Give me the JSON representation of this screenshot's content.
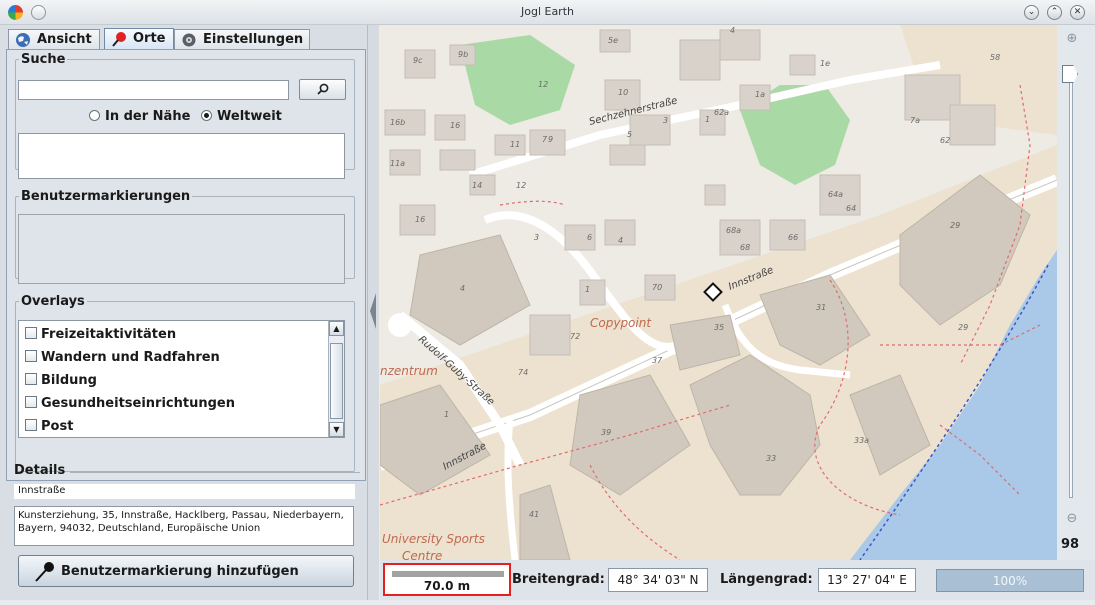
{
  "window": {
    "title": "Jogl Earth"
  },
  "tabs": [
    {
      "label": "Ansicht",
      "icon": "globe-icon"
    },
    {
      "label": "Orte",
      "icon": "pin-icon"
    },
    {
      "label": "Einstellungen",
      "icon": "settings-gear-icon"
    }
  ],
  "search": {
    "legend": "Suche",
    "input_value": "",
    "radio_nearby": "In der Nähe",
    "radio_worldwide": "Weltweit",
    "selected": "Weltweit"
  },
  "markers": {
    "legend": "Benutzermarkierungen"
  },
  "overlays": {
    "legend": "Overlays",
    "items": [
      "Freizeitaktivitäten",
      "Wandern und Radfahren",
      "Bildung",
      "Gesundheitseinrichtungen",
      "Post"
    ]
  },
  "details": {
    "legend": "Details",
    "name": "Innstraße",
    "address": "Kunsterziehung, 35, Innstraße, Hacklberg, Passau, Niederbayern, Bayern, 94032, Deutschland, Europäische Union",
    "add_button": "Benutzermarkierung hinzufügen"
  },
  "map": {
    "streets": [
      "Sechzehnerstraße",
      "Innstraße",
      "Rudolf-Guby-Straße",
      "Innstraße"
    ],
    "place_labels": [
      "Copypoint",
      "nzentrum",
      "University Sports",
      "Centre"
    ],
    "house_numbers": [
      "5e",
      "9c",
      "9b",
      "4",
      "1e",
      "58",
      "12",
      "10",
      "1a",
      "16b",
      "16",
      "3",
      "1",
      "62a",
      "7a",
      "7",
      "9",
      "11",
      "5",
      "62",
      "11a",
      "14",
      "12",
      "64a",
      "64",
      "16",
      "3",
      "6",
      "4",
      "68a",
      "68",
      "66",
      "29",
      "4",
      "1",
      "70",
      "31",
      "35",
      "72",
      "29",
      "37",
      "74",
      "1",
      "39",
      "33a",
      "33",
      "41"
    ]
  },
  "zoom": {
    "level": "98"
  },
  "statusbar": {
    "scale": "70.0 m",
    "lat_label": "Breitengrad:",
    "lat_value": "48° 34' 03\" N",
    "lon_label": "Längengrad:",
    "lon_value": "13° 27' 04\" E",
    "progress": "100%"
  },
  "colors": {
    "accent_red": "#e62020",
    "park_green": "#a9d9a4",
    "water_blue": "#aac8e8",
    "campus": "#ece2cf"
  }
}
